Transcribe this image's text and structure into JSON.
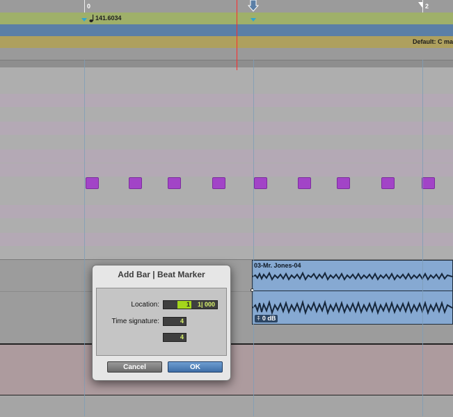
{
  "rulers": {
    "bar_labels": [
      "0",
      "2"
    ],
    "tempo_value": "141.6034",
    "key_signature": "Default: C ma"
  },
  "clip": {
    "name": "03-Mr. Jones-04",
    "gain": "0 dB"
  },
  "dialog": {
    "title": "Add Bar | Beat Marker",
    "location_label": "Location:",
    "location_bar": "1",
    "location_rest": "1| 000",
    "time_signature_label": "Time signature:",
    "time_sig_numerator": "4",
    "time_sig_denominator": "4",
    "cancel_label": "Cancel",
    "ok_label": "OK"
  },
  "colors": {
    "note": "#a244c7",
    "tempo_ruler": "#9fb06a",
    "meter_ruler": "#5b7fa6",
    "key_ruler": "#aea05e",
    "clip": "#86a9d2",
    "cursor": "#ff2a2a"
  }
}
